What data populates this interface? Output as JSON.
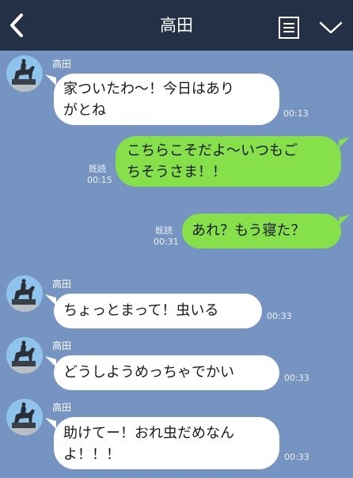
{
  "header": {
    "title": "高田"
  },
  "colors": {
    "background": "#7594c2",
    "header": "#243046",
    "incoming_bubble": "#ffffff",
    "outgoing_bubble": "#85e04a"
  },
  "icons": [
    "chevron-left-icon",
    "note-icon",
    "chevron-down-icon"
  ],
  "messages": [
    {
      "sender": "高田",
      "text": "家ついたわ〜！今日はあり\nがとね",
      "time": "00:13"
    },
    {
      "read": "既読",
      "text": "こちらこそだよ〜いつもご\nちそうさま！！",
      "time": "00:15"
    },
    {
      "read": "既読",
      "text": "あれ？もう寝た？",
      "time": "00:31"
    },
    {
      "sender": "高田",
      "text": "ちょっとまって！虫いる",
      "time": "00:33"
    },
    {
      "sender": "高田",
      "text": "どうしようめっちゃでかい",
      "time": "00:33"
    },
    {
      "sender": "高田",
      "text": "助けてー！おれ虫だめなん\nよ！！！",
      "time": "00:33"
    }
  ]
}
